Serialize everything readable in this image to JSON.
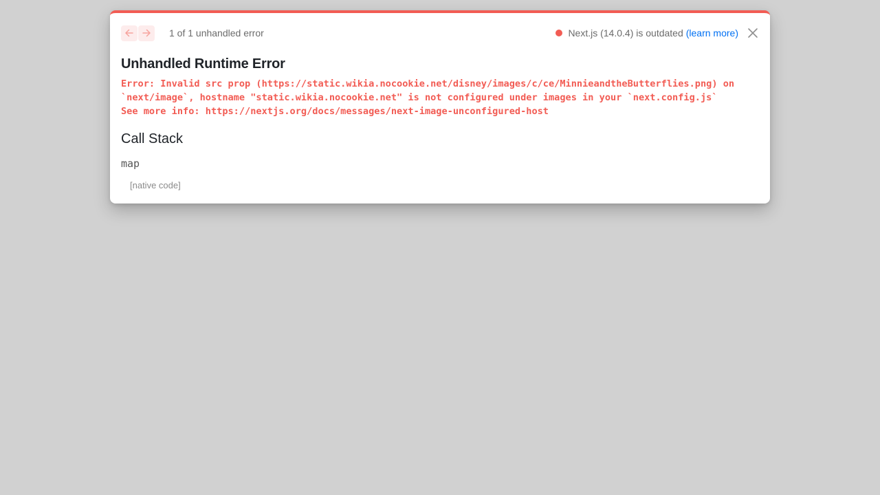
{
  "overlay": {
    "pager_text": "1 of 1 unhandled error",
    "version_text": "Next.js (14.0.4) is outdated",
    "learn_more_label": "(learn more)",
    "title": "Unhandled Runtime Error",
    "error_lines": [
      "Error: Invalid src prop (https://static.wikia.nocookie.net/disney/images/c/ce/MinnieandtheButterflies.png) on",
      "`next/image`, hostname \"static.wikia.nocookie.net\" is not configured under images in your `next.config.js`",
      "See more info: https://nextjs.org/docs/messages/next-image-unconfigured-host"
    ],
    "call_stack_title": "Call Stack",
    "frames": [
      {
        "function": "map",
        "location": "[native code]"
      }
    ]
  },
  "icons": {
    "prev": "arrow-left-icon",
    "next": "arrow-right-icon",
    "close": "close-icon",
    "status": "status-dot-icon"
  },
  "colors": {
    "accent": "#f25c54",
    "link": "#0070f3",
    "backdrop": "#d1d1d1"
  }
}
